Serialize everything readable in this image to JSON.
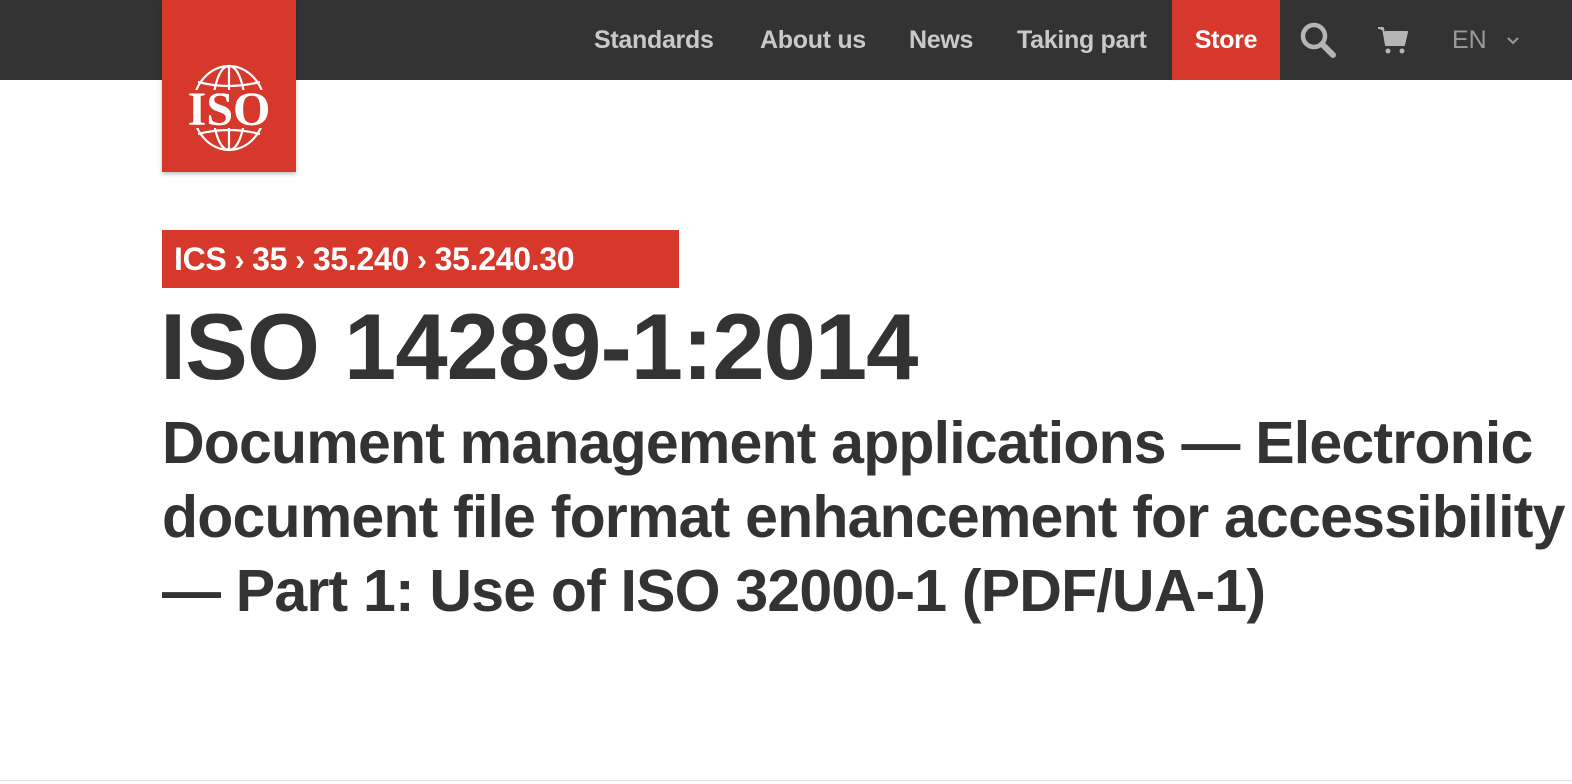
{
  "header": {
    "logo_text": "ISO",
    "nav": {
      "standards": "Standards",
      "about": "About us",
      "news": "News",
      "taking_part": "Taking part",
      "store": "Store"
    },
    "icons": {
      "search": "search-icon",
      "cart": "cart-icon",
      "chevron": "chevron-down-icon"
    },
    "language": "EN"
  },
  "breadcrumb": {
    "items": [
      "ICS",
      "35",
      "35.240",
      "35.240.30"
    ],
    "separator": "›"
  },
  "document": {
    "id": "ISO 14289-1:2014",
    "title": "Document management applications — Electronic document file format enhancement for accessibility — Part 1: Use of ISO 32000-1 (PDF/UA-1)"
  },
  "colors": {
    "brand_red": "#d6382c",
    "topbar": "#333333",
    "text": "#333333"
  }
}
